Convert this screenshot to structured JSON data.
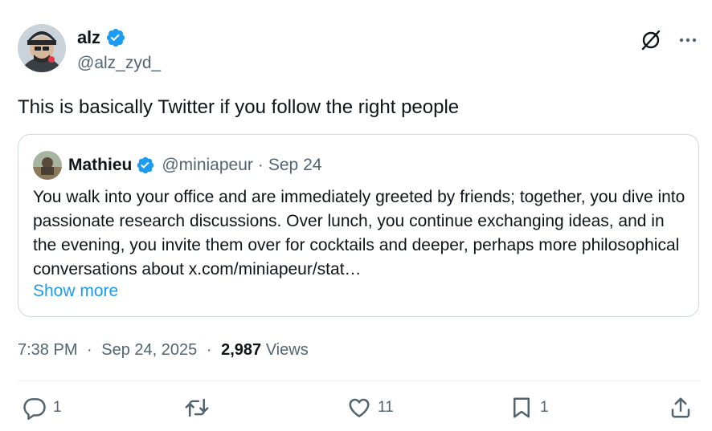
{
  "author": {
    "display_name": "alz",
    "handle": "@alz_zyd_",
    "verified": true
  },
  "header_icons": [
    "grok-icon",
    "more-icon"
  ],
  "tweet": {
    "text": "This is basically Twitter if you follow the right people"
  },
  "quote": {
    "display_name": "Mathieu",
    "handle": "@miniapeur",
    "separator": "·",
    "date": "Sep 24",
    "body": "You walk into your office and are immediately greeted by friends; together, you dive into passionate research discussions. Over lunch, you continue exchanging ideas, and in the evening, you invite them over for cocktails and deeper, perhaps more philosophical conversations about x.com/miniapeur/stat…",
    "show_more": "Show more"
  },
  "meta": {
    "time": "7:38 PM",
    "separator": "·",
    "date": "Sep 24, 2025",
    "views_count": "2,987",
    "views_label": "Views"
  },
  "actions": {
    "replies": "1",
    "retweets": "",
    "likes": "11",
    "bookmarks": "1"
  },
  "colors": {
    "accent": "#1d9bf0",
    "text_primary": "#0f1419",
    "text_secondary": "#536471",
    "border": "#cfd9de"
  }
}
